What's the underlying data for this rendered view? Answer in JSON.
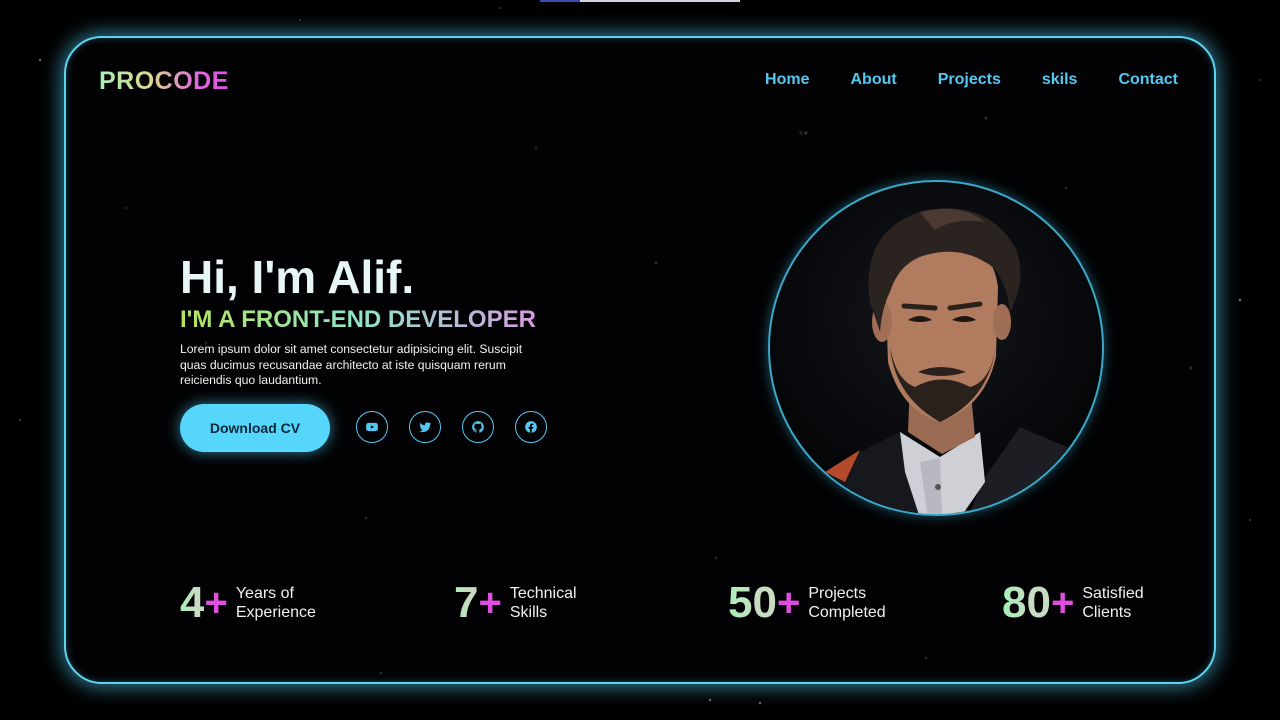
{
  "brand": {
    "logo": "PROCODE"
  },
  "nav": {
    "items": [
      "Home",
      "About",
      "Projects",
      "skils",
      "Contact"
    ]
  },
  "hero": {
    "title": "Hi, I'm Alif.",
    "subtitle": "I'M A FRONT-END DEVELOPER",
    "description_lines": [
      "Lorem ipsum dolor sit amet consectetur adipisicing elit. Suscipit",
      "quas ducimus recusandae architecto at iste quisquam rerum",
      "reiciendis quo laudantium."
    ],
    "cta_label": "Download CV",
    "socials": [
      "youtube-icon",
      "twitter-icon",
      "github-icon",
      "facebook-icon"
    ]
  },
  "stats": [
    {
      "number": "4",
      "plus": "+",
      "line1": "Years of",
      "line2": "Experience"
    },
    {
      "number": "7",
      "plus": "+",
      "line1": "Technical",
      "line2": "Skills"
    },
    {
      "number": "50",
      "plus": "+",
      "line1": "Projects",
      "line2": "Completed"
    },
    {
      "number": "80",
      "plus": "+",
      "line1": "Satisfied",
      "line2": "Clients"
    }
  ],
  "colors": {
    "accent": "#55c8f2",
    "button": "#57d6fb",
    "plus": "#e04ee0",
    "background": "#000000"
  }
}
